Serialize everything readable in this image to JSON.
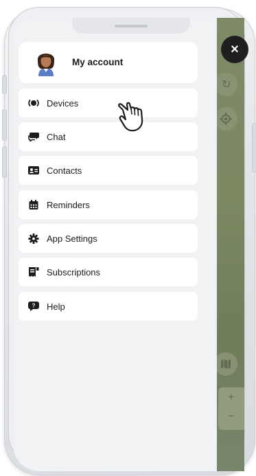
{
  "account": {
    "label": "My account"
  },
  "menu": {
    "items": [
      {
        "id": "devices",
        "label": "Devices",
        "icon": "devices-icon"
      },
      {
        "id": "chat",
        "label": "Chat",
        "icon": "chat-icon"
      },
      {
        "id": "contacts",
        "label": "Contacts",
        "icon": "contacts-icon"
      },
      {
        "id": "reminders",
        "label": "Reminders",
        "icon": "calendar-icon"
      },
      {
        "id": "app-settings",
        "label": "App Settings",
        "icon": "gear-icon"
      },
      {
        "id": "subscriptions",
        "label": "Subscriptions",
        "icon": "subscriptions-icon"
      },
      {
        "id": "help",
        "label": "Help",
        "icon": "help-icon"
      }
    ]
  },
  "controls": {
    "close_glyph": "×",
    "refresh_glyph": "↻",
    "zoom_in_glyph": "+",
    "zoom_out_glyph": "−"
  },
  "colors": {
    "drawer_bg": "#f1f2f4",
    "card_bg": "#ffffff",
    "map_green": "#7b8862",
    "close_bg": "#1f1f1f",
    "icon_dark": "#1c1c1c"
  }
}
